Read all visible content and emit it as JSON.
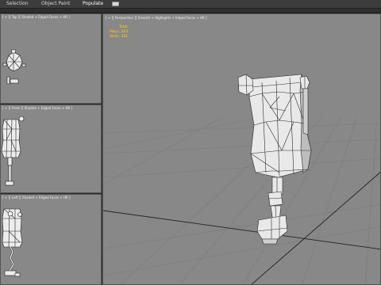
{
  "menu": {
    "tabs": [
      "Selection",
      "Object Paint",
      "Populate"
    ]
  },
  "viewports": {
    "top": {
      "label": "[ + ][ Top ][ Shaded + Edged Faces + HR ]"
    },
    "front": {
      "label": "[ + ][ Front ][ Shaded + Edged Faces + HR ]"
    },
    "left": {
      "label": "[ + ][ Left ][ Shaded + Edged Faces + HR ]"
    },
    "perspective": {
      "label": "[ + ][ Perspective ][ Smooth + Highlights + Edged Faces + HR ]",
      "stats": {
        "total": "Total",
        "polys": "Polys: 303",
        "verts": "Verts: 351"
      }
    }
  },
  "colors": {
    "viewport_bg": "#888888",
    "stats_text": "#ffd400",
    "mesh_fill": "#e9e9e9",
    "mesh_wire": "#2a2a2a"
  }
}
